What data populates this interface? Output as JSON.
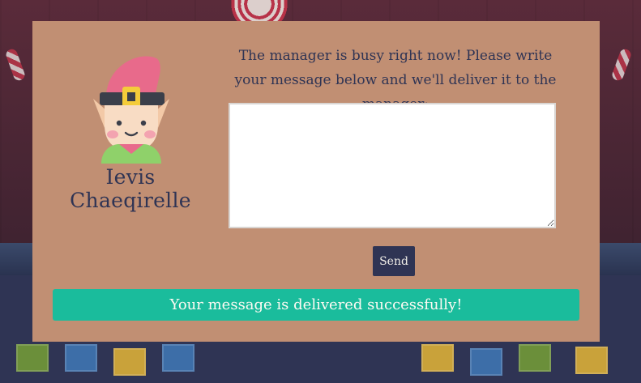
{
  "colors": {
    "dialog_bg": "#c18f73",
    "text_primary": "#2f3454",
    "button_bg": "#2f3454",
    "success_bg": "#1abc9c",
    "success_text": "#fdfaf3"
  },
  "elf": {
    "icon": "elf-avatar-icon",
    "name": "Ievis Chaeqirelle"
  },
  "prompt_text": "The manager is busy right now! Please write your message below and we'll deliver it to the manager:",
  "message": {
    "value": "",
    "placeholder": ""
  },
  "send_label": "Send",
  "alert_text": "Your message is delivered successfully!"
}
